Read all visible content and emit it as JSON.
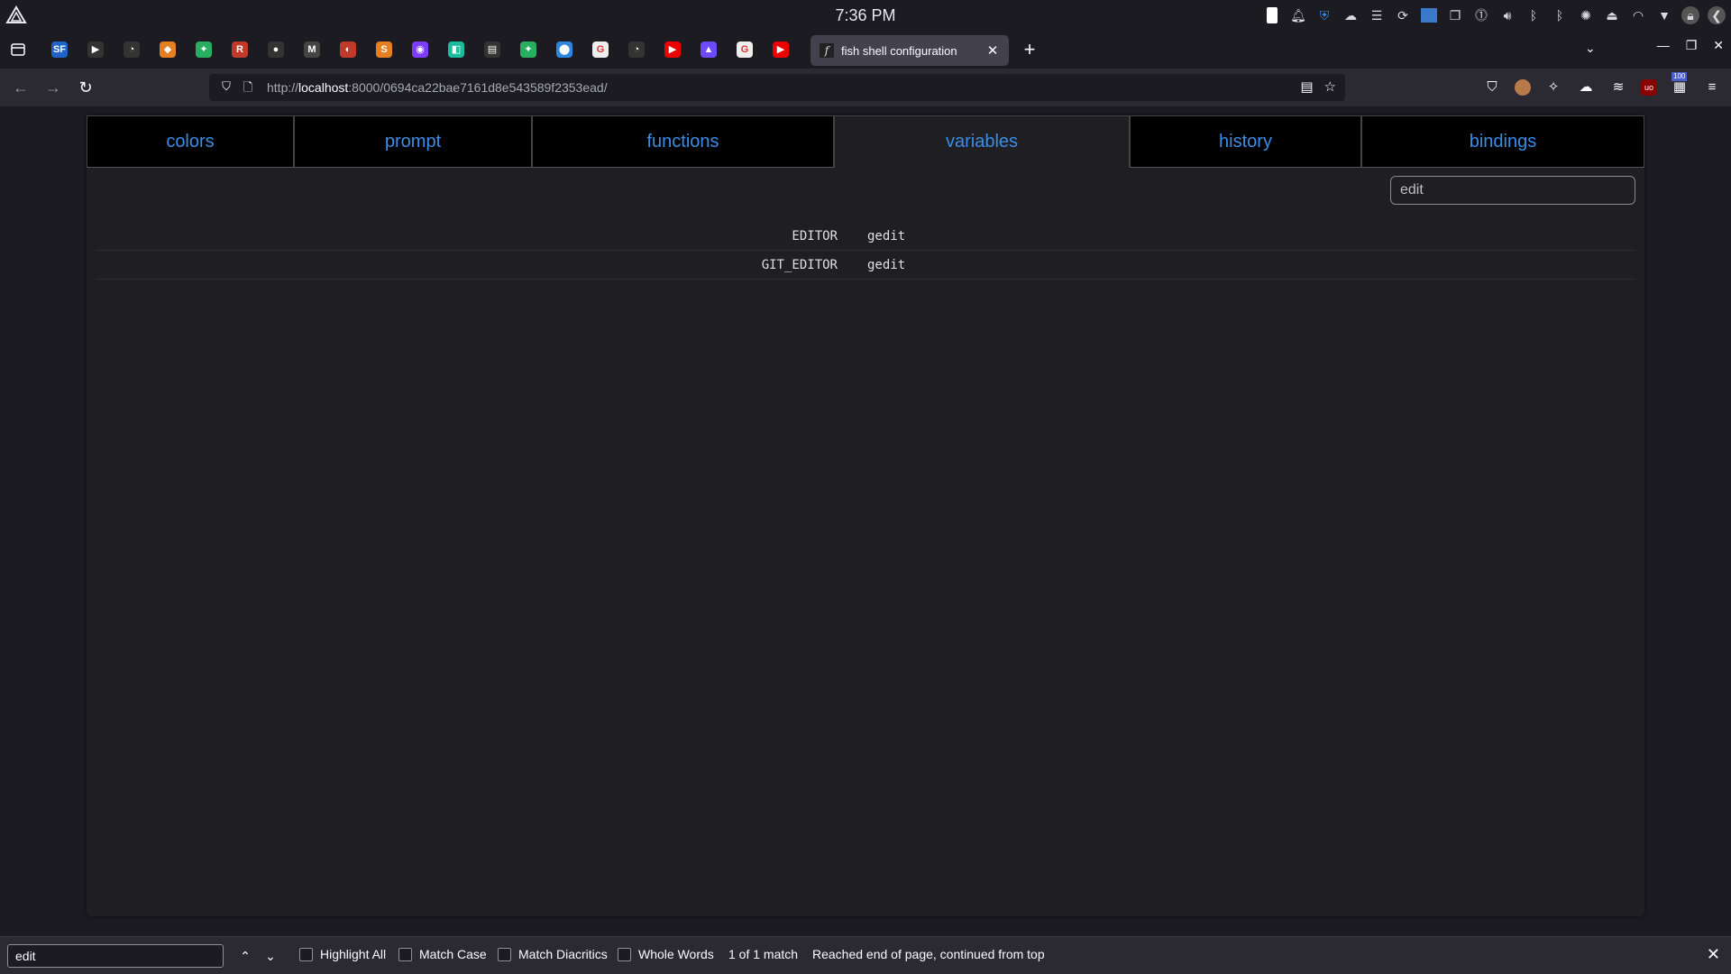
{
  "system": {
    "clock": "7:36 PM",
    "tray_icons": [
      "battery-icon",
      "notification-icon",
      "shield-icon",
      "cloud-icon",
      "clipboard-icon",
      "sync-icon",
      "screen-icon",
      "window-icon",
      "password-icon",
      "volume-icon",
      "bluetooth-icon",
      "bluetooth-icon",
      "brightness-icon",
      "display-icon",
      "wifi-icon",
      "dropdown-icon",
      "lock-icon",
      "logout-icon"
    ]
  },
  "browser": {
    "pinned_tabs": [
      {
        "icon": "sf-icon",
        "glyph": "SF",
        "color": "#1e63c5"
      },
      {
        "icon": "video-icon",
        "glyph": "▶",
        "color": "#333"
      },
      {
        "icon": "play-icon",
        "glyph": "◔",
        "color": "#333"
      },
      {
        "icon": "shield-orange-icon",
        "glyph": "◆",
        "color": "#e67e22"
      },
      {
        "icon": "color-wheel-icon",
        "glyph": "✦",
        "color": "#27ae60"
      },
      {
        "icon": "r-icon",
        "glyph": "R",
        "color": "#c0392b"
      },
      {
        "icon": "github-icon",
        "glyph": "●",
        "color": "#333"
      },
      {
        "icon": "gmail-icon",
        "glyph": "M",
        "color": "#444"
      },
      {
        "icon": "app-red-icon",
        "glyph": "◐",
        "color": "#c0392b"
      },
      {
        "icon": "s-orange-icon",
        "glyph": "S",
        "color": "#e67e22"
      },
      {
        "icon": "purple-shield-icon",
        "glyph": "◉",
        "color": "#7d3cff"
      },
      {
        "icon": "teal-icon",
        "glyph": "◧",
        "color": "#1abc9c"
      },
      {
        "icon": "screen-icon",
        "glyph": "▤",
        "color": "#333"
      },
      {
        "icon": "color-wheel-icon",
        "glyph": "✦",
        "color": "#27ae60"
      },
      {
        "icon": "maps-icon",
        "glyph": "⬤",
        "color": "#2e86de"
      },
      {
        "icon": "google-icon",
        "glyph": "G",
        "color": "#eee"
      },
      {
        "icon": "play-icon",
        "glyph": "◔",
        "color": "#333"
      },
      {
        "icon": "youtube-icon",
        "glyph": "▶",
        "color": "#e00"
      },
      {
        "icon": "proton-icon",
        "glyph": "▲",
        "color": "#6d4aff"
      },
      {
        "icon": "google-icon",
        "glyph": "G",
        "color": "#eee"
      },
      {
        "icon": "youtube-icon",
        "glyph": "▶",
        "color": "#e00"
      }
    ],
    "active_tab": {
      "favicon": "f",
      "title": "fish shell configuration"
    },
    "url_host": "localhost",
    "url_prefix": "http://",
    "url_rest": ":8000/0694ca22bae7161d8e543589f2353ead/",
    "badge_count": "100"
  },
  "app": {
    "tabs": [
      "colors",
      "prompt",
      "functions",
      "variables",
      "history",
      "bindings"
    ],
    "selected_tab": "variables",
    "filter_value": "edit",
    "variables": [
      {
        "name": "EDITOR",
        "value": "gedit"
      },
      {
        "name": "GIT_EDITOR",
        "value": "gedit"
      }
    ],
    "link_color": "#3a8de6"
  },
  "findbar": {
    "query": "edit",
    "options": {
      "highlight_all": "Highlight All",
      "match_case": "Match Case",
      "match_diacritics": "Match Diacritics",
      "whole_words": "Whole Words"
    },
    "match_count": "1 of 1 match",
    "status": "Reached end of page, continued from top"
  }
}
